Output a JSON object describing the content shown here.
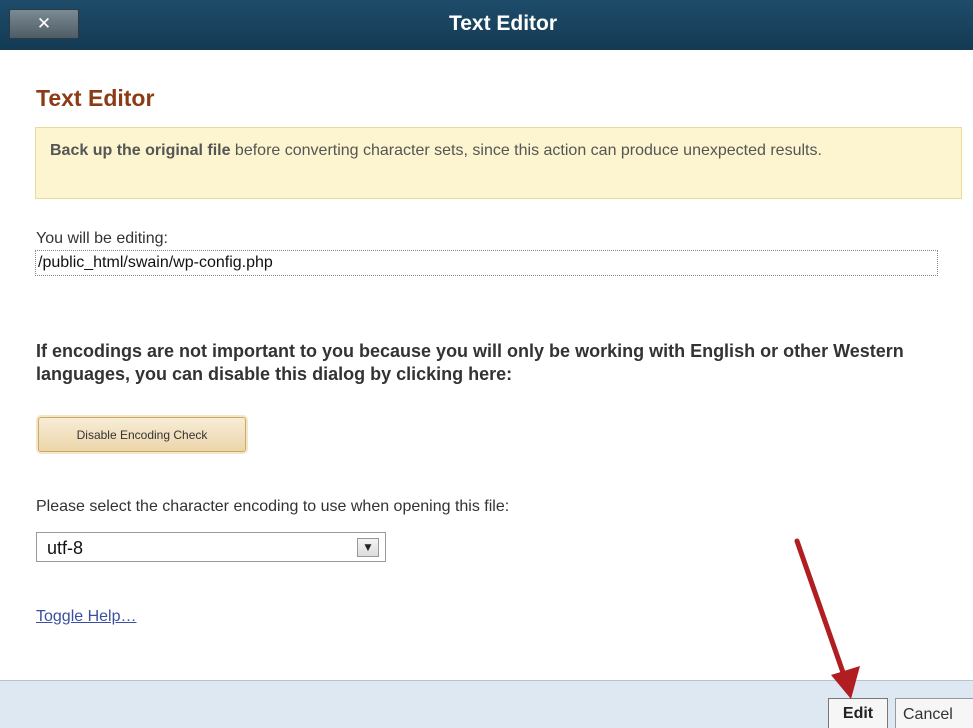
{
  "window": {
    "title": "Text Editor",
    "close_symbol": "✕"
  },
  "dialog": {
    "heading": "Text Editor",
    "warning_bold": "Back up the original file",
    "warning_rest": " before converting character sets, since this action can produce unexpected results.",
    "editing_label": "You will be editing:",
    "file_path": "/public_html/swain/wp-config.php",
    "encoding_note": "If encodings are not important to you because you will only be working with English or other Western languages, you can disable this dialog by clicking here:",
    "disable_button": "Disable Encoding Check",
    "select_label": "Please select the character encoding to use when opening this file:",
    "encoding_selected": "utf-8",
    "select_arrow": "▼",
    "toggle_help": "Toggle Help…"
  },
  "footer": {
    "edit_label": "Edit",
    "cancel_label": "Cancel"
  },
  "colors": {
    "titlebar": "#1e4c6a",
    "heading": "#8a3c14",
    "warning_bg": "#fcf5cf",
    "annotation_arrow": "#b01e22",
    "link": "#3a4fa0"
  },
  "icons": {
    "close": "close-icon",
    "dropdown": "chevron-down-icon",
    "annotation": "red-arrow-annotation"
  }
}
